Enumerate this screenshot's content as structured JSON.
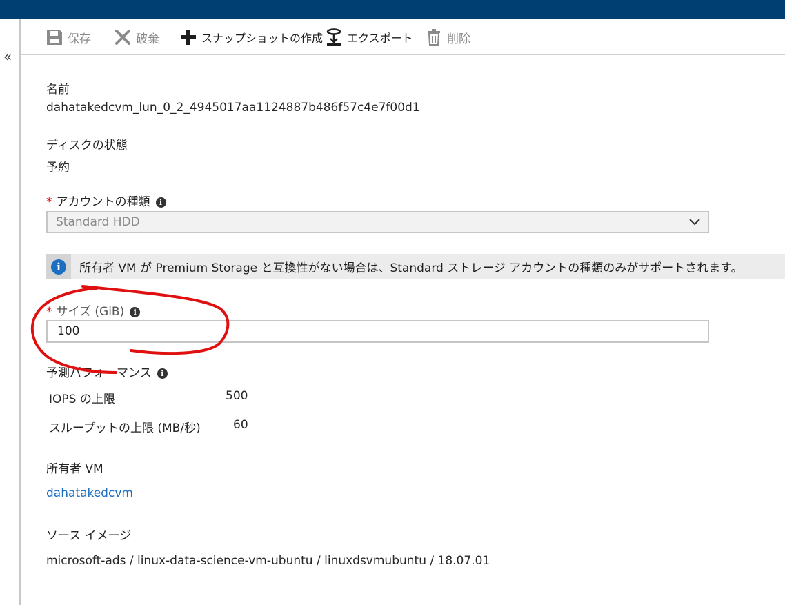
{
  "toolbar": {
    "items": [
      {
        "label": "保存",
        "icon": "save-icon",
        "enabled": false
      },
      {
        "label": "破棄",
        "icon": "discard-icon",
        "enabled": false
      },
      {
        "label": "スナップショットの作成",
        "icon": "plus-icon",
        "enabled": true
      },
      {
        "label": "エクスポート",
        "icon": "export-icon",
        "enabled": true
      },
      {
        "label": "削除",
        "icon": "trash-icon",
        "enabled": false
      }
    ]
  },
  "collapse_glyph": "«",
  "fields": {
    "name_label": "名前",
    "name_value": "dahatakedcvm_lun_0_2_4945017aa1124887b486f57c4e7f00d1",
    "disk_state_label": "ディスクの状態",
    "disk_state_value": "予約",
    "account_type_label": "アカウントの種類",
    "account_type_value": "Standard HDD",
    "info_message": "所有者 VM が Premium Storage と互換性がない場合は、Standard ストレージ アカウントの種類のみがサポートされます。",
    "size_label": "サイズ (GiB)",
    "size_value": "100",
    "perf_label": "予測パフォーマンス",
    "iops_label": "IOPS の上限",
    "iops_value": "500",
    "throughput_label": "スループットの上限 (MB/秒)",
    "throughput_value": "60",
    "owner_vm_label": "所有者 VM",
    "owner_vm_value": "dahatakedcvm",
    "source_image_label": "ソース イメージ",
    "source_image_value": "microsoft-ads / linux-data-science-vm-ubuntu / linuxdsvmubuntu / 18.07.01"
  },
  "colors": {
    "topbar": "#003f72",
    "link": "#1b6ec2",
    "required": "#ee0000",
    "annotation": "#e01010"
  },
  "required_mark": "*",
  "info_glyph": "i"
}
